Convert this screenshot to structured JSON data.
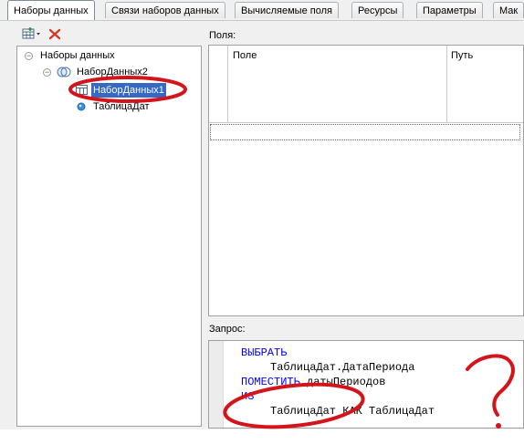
{
  "tabs": [
    {
      "label": "Наборы данных",
      "active": true
    },
    {
      "label": "Связи наборов данных",
      "active": false
    },
    {
      "label": "Вычисляемые поля",
      "active": false
    },
    {
      "label": "Ресурсы",
      "active": false
    },
    {
      "label": "Параметры",
      "active": false
    },
    {
      "label": "Мак",
      "active": false
    }
  ],
  "toolbar": {
    "add_icon": "add-dataset-icon",
    "delete_icon": "delete-icon"
  },
  "tree": {
    "root": "Наборы данных",
    "union": "НаборДанных2",
    "child_selected": "НаборДанных1",
    "child_object": "ТаблицаДат"
  },
  "fields": {
    "label": "Поля:",
    "columns": [
      "Поле",
      "Путь"
    ]
  },
  "query": {
    "label": "Запрос:",
    "lines": [
      {
        "kw": "ВЫБРАТЬ",
        "text": ""
      },
      {
        "kw": "",
        "text": "ТаблицаДат.ДатаПериода"
      },
      {
        "kw": "ПОМЕСТИТЬ",
        "text": " датыПериодов"
      },
      {
        "kw": "ИЗ",
        "text": ""
      },
      {
        "kw": "",
        "text": "ТаблицаДат КАК ТаблицаДат"
      }
    ]
  },
  "colors": {
    "accent": "#3569c4",
    "annotation": "#d4141b",
    "keyword": "#0000ff"
  }
}
